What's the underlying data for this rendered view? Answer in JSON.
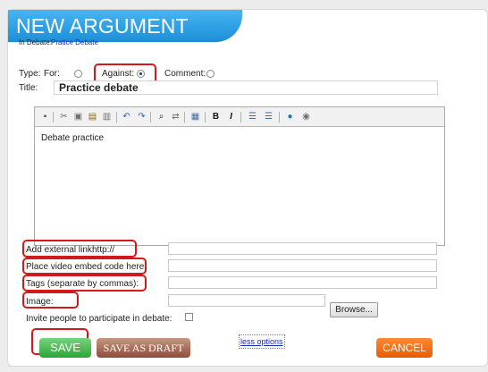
{
  "page": {
    "title": "NEW ARGUMENT",
    "debate_label": "In Debate:",
    "debate_name": "Pratice Debate"
  },
  "type": {
    "label": "Type:",
    "options": [
      "For:",
      "Against:",
      "Comment:"
    ],
    "selected": "Against:"
  },
  "title_field": {
    "label": "Title:",
    "value": "Practice debate"
  },
  "editor": {
    "content": "Debate practice"
  },
  "links": {
    "label": "Add external link:",
    "value": "http://"
  },
  "video": {
    "label": "Place video embed code here"
  },
  "tags": {
    "label": "Tags (separate by commas):"
  },
  "image": {
    "label": "Image:",
    "browse_label": "Browse..."
  },
  "invite": {
    "label": "Invite people to participate in debate:"
  },
  "buttons": {
    "save": "SAVE",
    "save_draft": "SAVE AS DRAFT",
    "less_options": "less options",
    "cancel": "CANCEL"
  },
  "colors": {
    "header": "#1a8fd9",
    "highlight": "#d21a1a",
    "save": "#2aa636",
    "draft": "#8f4c3b",
    "cancel": "#e65c00"
  },
  "toolbar": {
    "icons": [
      "bookmark-icon",
      "cut-icon",
      "copy-icon",
      "paste-icon",
      "paste-text-icon",
      "undo-icon",
      "redo-icon",
      "find-icon",
      "replace-icon",
      "table-icon",
      "bold-icon",
      "italic-icon",
      "numbered-list-icon",
      "bulleted-list-icon",
      "link-icon",
      "unlink-icon"
    ]
  }
}
